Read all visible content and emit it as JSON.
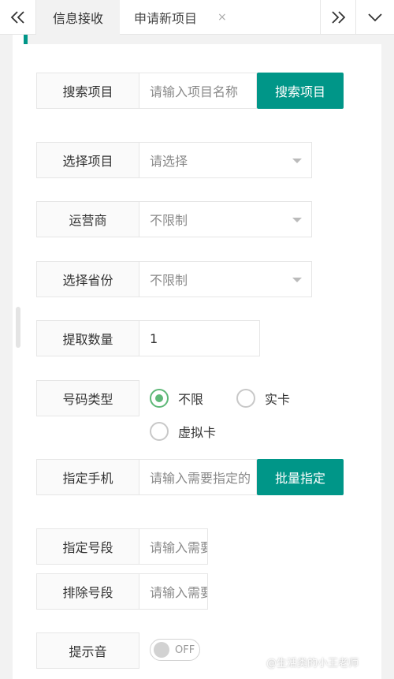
{
  "tabs": [
    {
      "label": "信息接收",
      "active": true
    },
    {
      "label": "申请新项目",
      "close_glyph": "×"
    }
  ],
  "icons": {
    "prev": "double-chevron-left-icon",
    "next": "double-chevron-right-icon",
    "menu": "chevron-down-icon"
  },
  "accent_color": "#009688",
  "form": {
    "search": {
      "label": "搜索项目",
      "placeholder": "请输入项目名称",
      "button": "搜索项目"
    },
    "select_project": {
      "label": "选择项目",
      "value": "请选择"
    },
    "operator": {
      "label": "运营商",
      "value": "不限制"
    },
    "province": {
      "label": "选择省份",
      "value": "不限制"
    },
    "quantity": {
      "label": "提取数量",
      "value": "1"
    },
    "number_type": {
      "label": "号码类型",
      "options": [
        {
          "label": "不限",
          "checked": true
        },
        {
          "label": "实卡",
          "checked": false
        },
        {
          "label": "虚拟卡",
          "checked": false
        }
      ]
    },
    "phone": {
      "label": "指定手机",
      "placeholder": "请输入需要指定的",
      "button": "批量指定"
    },
    "segment": {
      "label": "指定号段",
      "placeholder": "请输入需要"
    },
    "exclude": {
      "label": "排除号段",
      "placeholder": "请输入需要"
    },
    "sound": {
      "label": "提示音",
      "state": "OFF"
    }
  },
  "watermark": "@生活类的小王老师"
}
